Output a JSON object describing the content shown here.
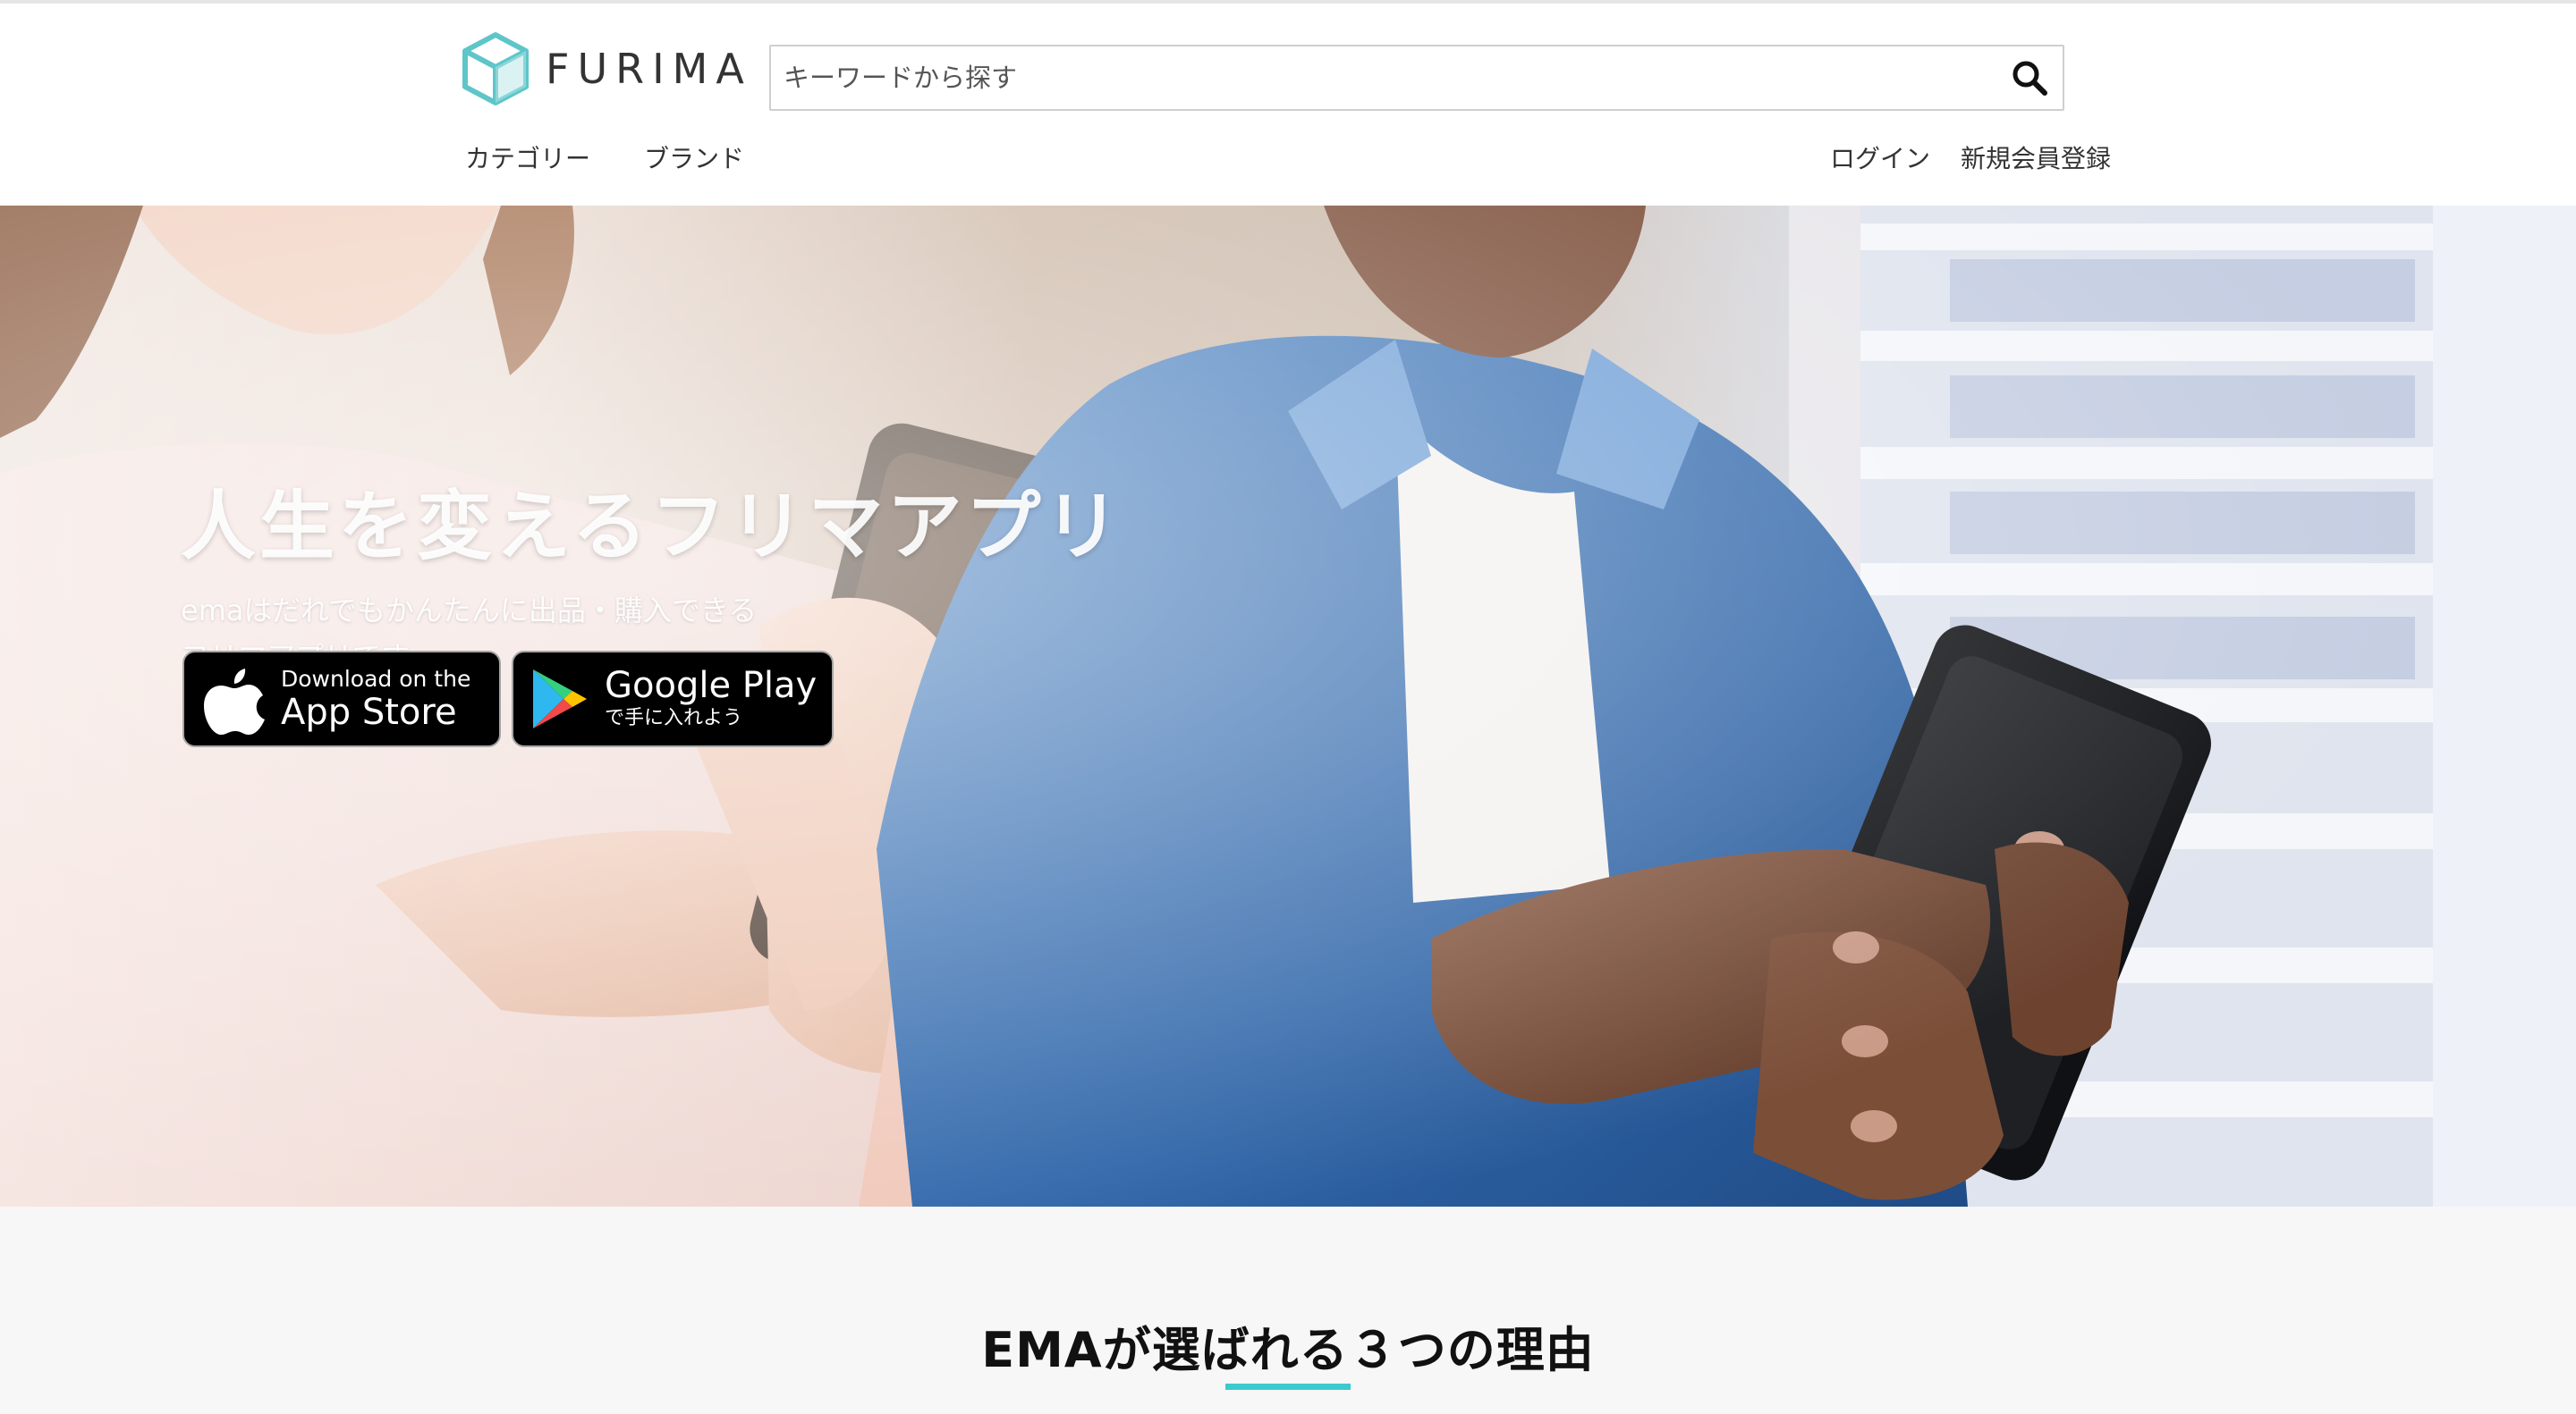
{
  "header": {
    "logo_text": "FURIMA",
    "logo_icon": "cube-icon",
    "search": {
      "placeholder": "キーワードから探す",
      "value": "",
      "icon": "search-icon"
    },
    "nav_left": [
      "カテゴリー",
      "ブランド"
    ],
    "nav_right": [
      "ログイン",
      "新規会員登録"
    ]
  },
  "hero": {
    "title": "人生を変えるフリマアプリ",
    "subtitle_line1": "emaはだれでもかんたんに出品・購入できる",
    "subtitle_line2": "フリマアプリです",
    "app_store": {
      "small": "Download on the",
      "big": "App Store",
      "icon": "apple-icon"
    },
    "google_play": {
      "big": "Google Play",
      "small": "で手に入れよう",
      "icon": "google-play-icon"
    }
  },
  "reasons": {
    "title": "EMAが選ばれる３つの理由"
  },
  "colors": {
    "accent": "#3ccace",
    "logo": "#5ec6c9",
    "text": "#333333"
  }
}
